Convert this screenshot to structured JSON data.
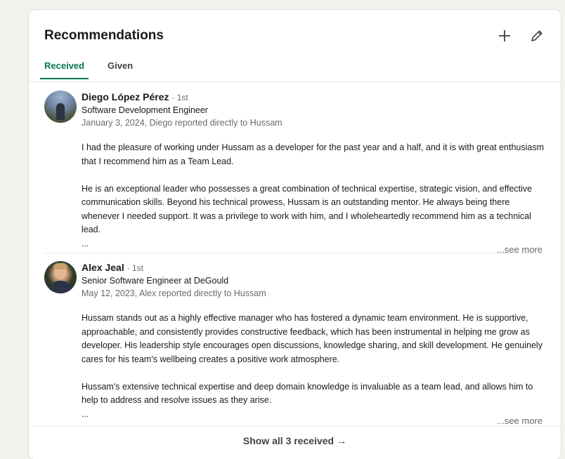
{
  "section": {
    "title": "Recommendations",
    "add_icon": "plus-icon",
    "edit_icon": "pencil-icon"
  },
  "tabs": [
    {
      "label": "Received",
      "active": true
    },
    {
      "label": "Given",
      "active": false
    }
  ],
  "recommendations": [
    {
      "name": "Diego López Pérez",
      "degree": "· 1st",
      "headline": "Software Development Engineer",
      "date": "January 3, 2024, Diego reported directly to Hussam",
      "paragraphs": [
        "I had the pleasure of working under Hussam as a developer for the past year and a half, and it is with great enthusiasm that I recommend him as a Team Lead.",
        "He is an exceptional leader who possesses a great combination of technical expertise, strategic vision, and effective communication skills. Beyond his technical prowess, Hussam is an outstanding mentor. He always being there whenever I needed support. It was a privilege to work with him, and I wholeheartedly recommend him as a technical lead."
      ],
      "ellipsis": "...",
      "see_more": "...see more"
    },
    {
      "name": "Alex Jeal",
      "degree": "· 1st",
      "headline": "Senior Software Engineer at DeGould",
      "date": "May 12, 2023, Alex reported directly to Hussam",
      "paragraphs": [
        "Hussam stands out as a highly effective manager who has fostered a dynamic team environment. He is supportive, approachable, and consistently provides constructive feedback, which has been instrumental in helping me grow as developer. His leadership style encourages open discussions, knowledge sharing, and skill development. He genuinely cares for his team's wellbeing creates a positive work atmosphere.",
        "Hussam's extensive technical expertise and deep domain knowledge is invaluable as a team lead, and allows him to help to address and resolve issues as they arise."
      ],
      "ellipsis": "...",
      "see_more": "...see more"
    }
  ],
  "footer": {
    "label": "Show all 3 received",
    "arrow": "→"
  },
  "colors": {
    "accent": "#01754f",
    "page_bg": "#f4f2ee",
    "card_bg": "#ffffff"
  }
}
